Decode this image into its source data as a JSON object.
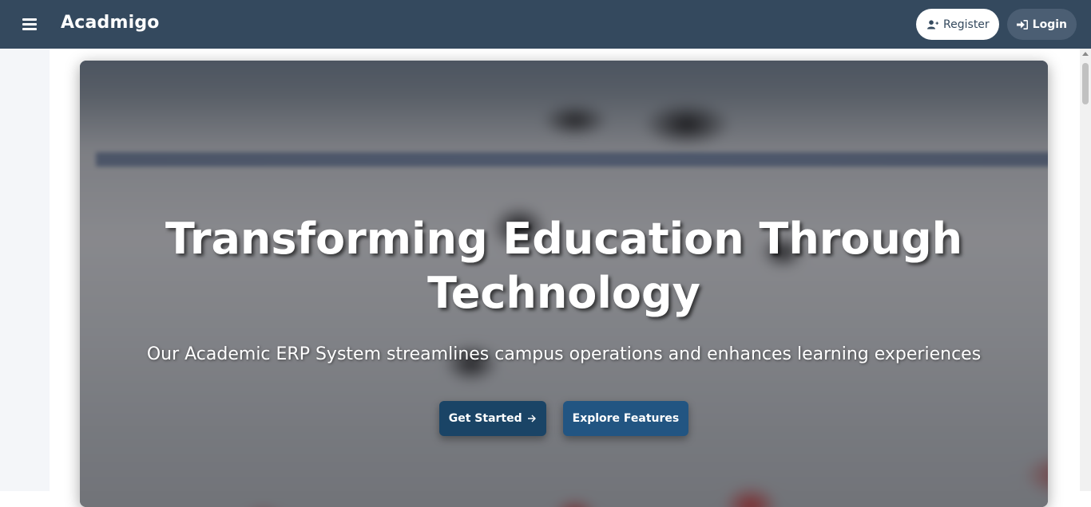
{
  "app": {
    "brand": "Acadmigo"
  },
  "navbar": {
    "menu_icon": "hamburger-menu-icon",
    "register_label": "Register",
    "register_icon": "user-plus-icon",
    "login_label": "Login",
    "login_icon": "sign-in-icon"
  },
  "hero": {
    "title_line1": "Transforming Education Through",
    "title_line2": "Technology",
    "subtitle": "Our Academic ERP System streamlines campus operations and enhances learning experiences",
    "get_started_label": "Get Started",
    "get_started_icon": "arrow-right-icon",
    "explore_label": "Explore Features"
  },
  "colors": {
    "navbar_bg": "#34495e",
    "button_primary": "#1a4466",
    "button_secondary": "#225582",
    "page_bg": "#ffffff"
  }
}
